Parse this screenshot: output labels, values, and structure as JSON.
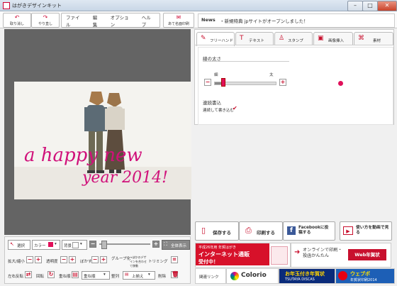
{
  "window": {
    "title": "はがきデザインキット",
    "min": "–",
    "max": "□",
    "close": "✕"
  },
  "toolbar": {
    "undo_label": "取り消し",
    "redo_label": "やり直し",
    "menu": [
      "ファイル",
      "編集",
      "オプション",
      "ヘルプ"
    ],
    "address_label": "あて名面印刷"
  },
  "news": {
    "label": "News",
    "text": "・新規特典 jpサイトがオープンしました！"
  },
  "canvas": {
    "handwriting_line1": "a happy new",
    "handwriting_line2": "year 2014!",
    "ink_color": "#d0107a"
  },
  "panel": {
    "tabs": [
      "フリーハンド",
      "テキスト",
      "スタンプ",
      "画像挿入",
      "素材"
    ],
    "active_tab": "フリーハンド",
    "line_width_title": "線の太さ",
    "thin_label": "細",
    "thick_label": "太",
    "slider_level_fraction": 0.15,
    "continuous_title": "連続書込",
    "continuous_label": "連続して書き込む",
    "continuous_checked": true,
    "preview_dot_color": "#e0105a"
  },
  "bottom_controls": {
    "select_label": "選択",
    "color_label": "カラー",
    "color_value": "#e0105a",
    "background_label": "背景",
    "fit_label": "全体表示",
    "enlarge_label": "拡大/縮小",
    "opacity_label": "透明度",
    "blur_label": "ぼかす",
    "group_label": "グループ化",
    "group_sub": "→ほかのデザインを合わせて移動",
    "trimming_label": "トリミング",
    "flip_label": "左右反転",
    "rotate_label": "回転",
    "backward_label": "重ね順",
    "order_label": "重ね順",
    "align_label": "整列",
    "align_value": "上揃え",
    "delete_label": "削除"
  },
  "actions": {
    "save_label": "保存する",
    "print_label": "印刷する",
    "facebook_label": "Facebookに投稿する",
    "howto_label": "使い方を動画で見る"
  },
  "ads": {
    "ad1_top": "平成26年用 年賀はがき",
    "ad1_main": "インターネット通販",
    "ad1_sub": "受付中！",
    "ad2_main": "オンラインで印刷・投函かんたん",
    "ad2_brand": "Web年賀状",
    "link_label": "関連リンク",
    "colorio": "Colorio",
    "ad3_main": "お年玉付き年賀状",
    "ad3_sub": "TSUTAYA DISCAS",
    "ad4_main": "ウェブポ",
    "ad4_sub": "年賀状印刷2014"
  }
}
